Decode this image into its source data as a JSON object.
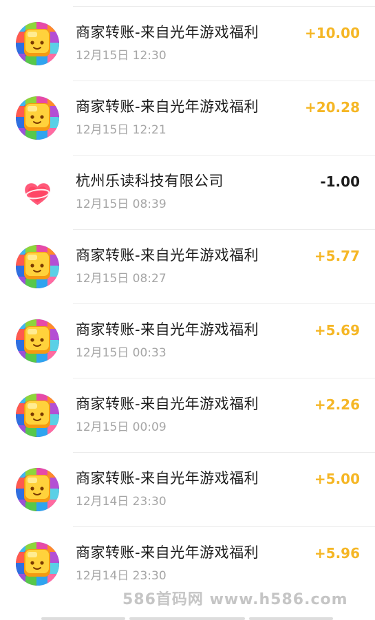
{
  "transactions": [
    {
      "title": "商家转账-来自光年游戏福利",
      "time": "12月15日 12:30",
      "amount": "+10.00",
      "type": "credit",
      "icon": "game-blocks-icon"
    },
    {
      "title": "商家转账-来自光年游戏福利",
      "time": "12月15日 12:21",
      "amount": "+20.28",
      "type": "credit",
      "icon": "game-blocks-icon"
    },
    {
      "title": "杭州乐读科技有限公司",
      "time": "12月15日 08:39",
      "amount": "-1.00",
      "type": "debit",
      "icon": "pink-heart-icon"
    },
    {
      "title": "商家转账-来自光年游戏福利",
      "time": "12月15日 08:27",
      "amount": "+5.77",
      "type": "credit",
      "icon": "game-blocks-icon"
    },
    {
      "title": "商家转账-来自光年游戏福利",
      "time": "12月15日 00:33",
      "amount": "+5.69",
      "type": "credit",
      "icon": "game-blocks-icon"
    },
    {
      "title": "商家转账-来自光年游戏福利",
      "time": "12月15日 00:09",
      "amount": "+2.26",
      "type": "credit",
      "icon": "game-blocks-icon"
    },
    {
      "title": "商家转账-来自光年游戏福利",
      "time": "12月14日 23:30",
      "amount": "+5.00",
      "type": "credit",
      "icon": "game-blocks-icon"
    },
    {
      "title": "商家转账-来自光年游戏福利",
      "time": "12月14日 23:30",
      "amount": "+5.96",
      "type": "credit",
      "icon": "game-blocks-icon"
    }
  ],
  "watermark": "586首码网 www.h586.com",
  "colors": {
    "credit": "#f5b624",
    "debit": "#1b1b1b",
    "time": "#a6a6a6"
  }
}
